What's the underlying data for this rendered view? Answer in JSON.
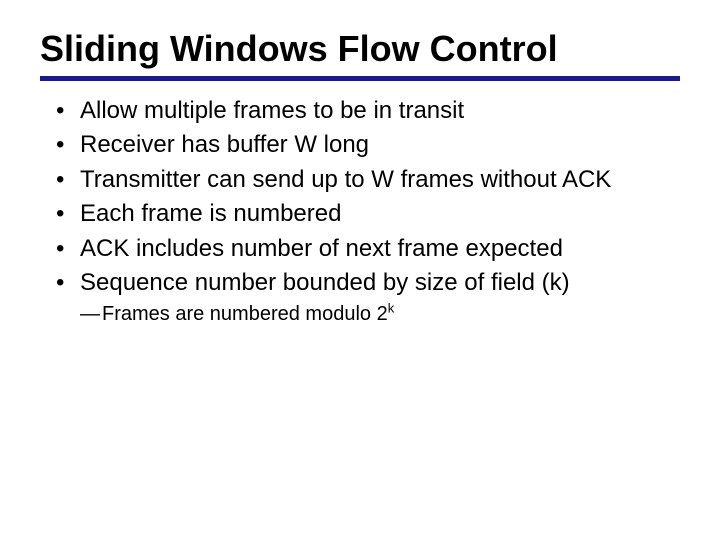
{
  "title": "Sliding Windows Flow Control",
  "bullets": [
    "Allow multiple frames to be in transit",
    "Receiver has buffer W long",
    "Transmitter can send up to W frames without ACK",
    "Each frame is numbered",
    "ACK includes number of next frame expected",
    "Sequence number bounded by size of field (k)"
  ],
  "sub": {
    "dash": "—",
    "text_pre": "Frames are numbered modulo 2",
    "sup": "k"
  }
}
